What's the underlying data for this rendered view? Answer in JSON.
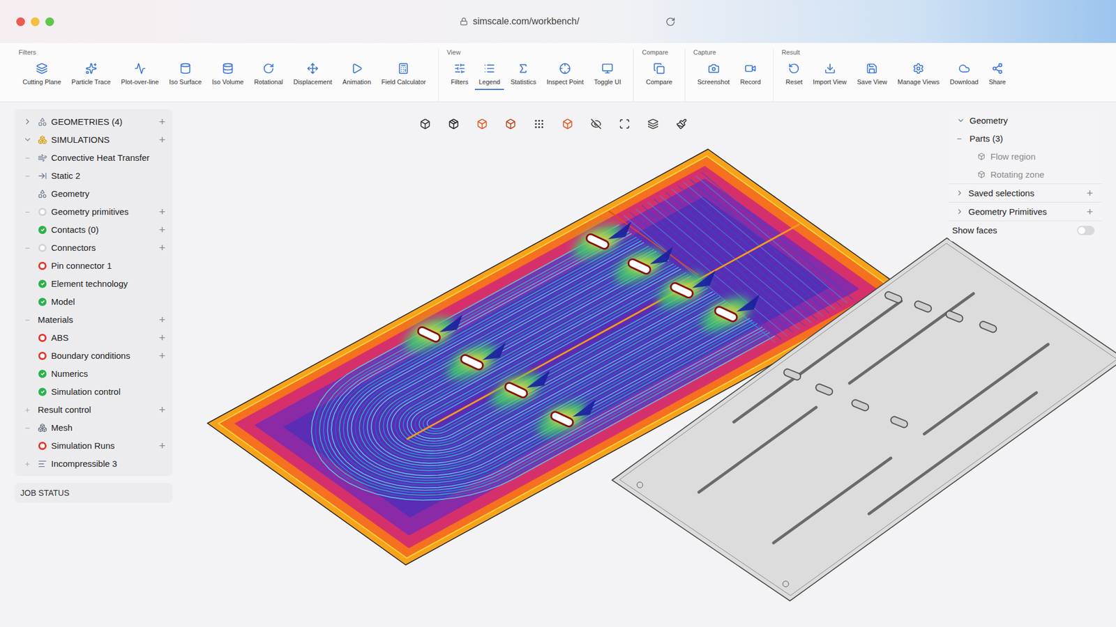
{
  "window": {
    "url": "simscale.com/workbench/"
  },
  "toolbar": {
    "groups": [
      {
        "title": "Filters",
        "items": [
          {
            "label": "Cutting Plane",
            "selected": false
          },
          {
            "label": "Particle Trace",
            "selected": false
          },
          {
            "label": "Plot-over-line",
            "selected": false
          },
          {
            "label": "Iso Surface",
            "selected": false
          },
          {
            "label": "Iso Volume",
            "selected": false
          },
          {
            "label": "Rotational",
            "selected": false
          },
          {
            "label": "Displacement",
            "selected": false
          },
          {
            "label": "Animation",
            "selected": false
          },
          {
            "label": "Field Calculator",
            "selected": false
          }
        ]
      },
      {
        "title": "View",
        "items": [
          {
            "label": "Filters",
            "selected": false
          },
          {
            "label": "Legend",
            "selected": true
          },
          {
            "label": "Statistics",
            "selected": false
          },
          {
            "label": "Inspect Point",
            "selected": false
          },
          {
            "label": "Toggle UI",
            "selected": false
          }
        ]
      },
      {
        "title": "Compare",
        "items": [
          {
            "label": "Compare",
            "selected": false
          }
        ]
      },
      {
        "title": "Capture",
        "items": [
          {
            "label": "Screenshot",
            "selected": false
          },
          {
            "label": "Record",
            "selected": false
          }
        ]
      },
      {
        "title": "Result",
        "items": [
          {
            "label": "Reset",
            "selected": false
          },
          {
            "label": "Import View",
            "selected": false
          },
          {
            "label": "Save View",
            "selected": false
          },
          {
            "label": "Manage Views",
            "selected": false
          },
          {
            "label": "Download",
            "selected": false
          },
          {
            "label": "Share",
            "selected": false
          }
        ]
      }
    ]
  },
  "sidebar": {
    "sections": [
      {
        "label": "GEOMETRIES (4)",
        "expanded": false,
        "add": "+"
      },
      {
        "label": "SIMULATIONS",
        "expanded": true,
        "add": "+"
      }
    ],
    "tree": [
      {
        "label": "Convective Heat Transfer",
        "kind": "sim",
        "expander": "−",
        "add": ""
      },
      {
        "label": "Static 2",
        "kind": "static",
        "expander": "−",
        "add": ""
      },
      {
        "label": "Geometry",
        "kind": "geometry",
        "expander": "",
        "add": ""
      },
      {
        "label": "Geometry primitives",
        "kind": "empty",
        "expander": "−",
        "add": "+"
      },
      {
        "label": "Contacts (0)",
        "kind": "ok",
        "expander": "",
        "add": "+"
      },
      {
        "label": "Connectors",
        "kind": "empty",
        "expander": "−",
        "add": "+"
      },
      {
        "label": "Pin connector 1",
        "kind": "error",
        "expander": "",
        "add": ""
      },
      {
        "label": "Element technology",
        "kind": "ok",
        "expander": "",
        "add": ""
      },
      {
        "label": "Model",
        "kind": "ok",
        "expander": "",
        "add": ""
      },
      {
        "label": "Materials",
        "kind": "none",
        "expander": "−",
        "add": "+"
      },
      {
        "label": "ABS",
        "kind": "error",
        "expander": "",
        "add": "+"
      },
      {
        "label": "Boundary conditions",
        "kind": "error",
        "expander": "",
        "add": "+"
      },
      {
        "label": "Numerics",
        "kind": "ok",
        "expander": "",
        "add": ""
      },
      {
        "label": "Simulation control",
        "kind": "ok",
        "expander": "",
        "add": ""
      },
      {
        "label": "Result control",
        "kind": "none",
        "expander": "+",
        "add": "+"
      },
      {
        "label": "Mesh",
        "kind": "mesh",
        "expander": "−",
        "add": ""
      },
      {
        "label": "Simulation Runs",
        "kind": "error",
        "expander": "",
        "add": "+"
      },
      {
        "label": "Incompressible 3",
        "kind": "incompressible",
        "expander": "+",
        "add": ""
      }
    ],
    "job_status": "JOB STATUS"
  },
  "right_panel": {
    "title": "Geometry",
    "expanded": true,
    "parts": {
      "label": "Parts (3)",
      "expander": "−",
      "items": [
        "Flow region",
        "Rotating zone"
      ]
    },
    "rows": [
      {
        "label": "Saved selections",
        "expanded": false,
        "add": "+"
      },
      {
        "label": "Geometry Primitives",
        "expanded": false,
        "add": "+"
      }
    ],
    "show_faces": {
      "label": "Show faces",
      "on": false
    }
  }
}
